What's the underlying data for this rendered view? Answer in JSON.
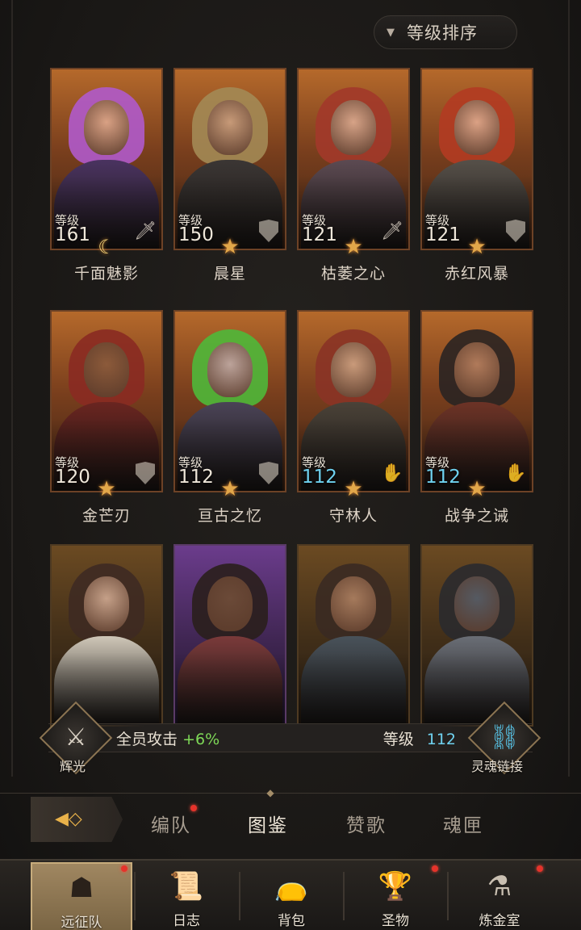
{
  "sort": {
    "label": "等级排序"
  },
  "heroes": [
    {
      "name": "千面魅影",
      "level_caption": "等级",
      "level": "161",
      "class": "sword-icon",
      "star": "moon-icon",
      "palette": [
        "#b05acb",
        "#d9a184",
        "#4a3360"
      ]
    },
    {
      "name": "晨星",
      "level_caption": "等级",
      "level": "150",
      "class": "shield-icon",
      "star": "star-icon",
      "palette": [
        "#a38a55",
        "#c79a78",
        "#3b3634"
      ]
    },
    {
      "name": "枯萎之心",
      "level_caption": "等级",
      "level": "121",
      "class": "sword-icon",
      "star": "star-icon",
      "palette": [
        "#a2382a",
        "#d7a387",
        "#5c4a52"
      ]
    },
    {
      "name": "赤红风暴",
      "level_caption": "等级",
      "level": "121",
      "class": "shield-icon",
      "star": "star-icon",
      "palette": [
        "#b23b22",
        "#dba184",
        "#565049"
      ]
    },
    {
      "name": "金芒刃",
      "level_caption": "等级",
      "level": "120",
      "class": "shield-icon",
      "star": "star-icon",
      "palette": [
        "#8a2a22",
        "#8c5a3a",
        "#6a2520"
      ]
    },
    {
      "name": "亘古之忆",
      "level_caption": "等级",
      "level": "112",
      "class": "shield-icon",
      "star": "star-icon",
      "palette": [
        "#4fb83a",
        "#bca39a",
        "#4a4356"
      ]
    },
    {
      "name": "守林人",
      "level_caption": "等级",
      "level": "112",
      "level_color": "cyan",
      "class": "hand-icon",
      "star": "star-icon",
      "palette": [
        "#8a3326",
        "#c99a7a",
        "#4a4238"
      ]
    },
    {
      "name": "战争之诫",
      "level_caption": "等级",
      "level": "112",
      "level_color": "cyan",
      "class": "hand-icon",
      "star": "star-icon",
      "palette": [
        "#2a2422",
        "#b07a5a",
        "#6d3326"
      ]
    },
    {
      "name": "",
      "palette": [
        "#3e2a22",
        "#c5a088",
        "#cfc7b8"
      ]
    },
    {
      "name": "",
      "palette": [
        "#2a1f1c",
        "#6b4a38",
        "#7a3a3a"
      ]
    },
    {
      "name": "",
      "palette": [
        "#3a2a22",
        "#a57a5c",
        "#49525a"
      ]
    },
    {
      "name": "",
      "palette": [
        "#2a2a2e",
        "#555a62",
        "#6a6e76"
      ]
    }
  ],
  "stats": {
    "left_badge": {
      "label": "辉光",
      "icon": "sword-emblem-icon"
    },
    "buff_label": "全员攻击",
    "buff_value": "+6%",
    "level_label": "等级",
    "level_value": "112",
    "right_badge": {
      "label": "灵魂链接",
      "icon": "chain-link-icon"
    }
  },
  "tabs": [
    {
      "label": "编队",
      "badge": true
    },
    {
      "label": "图鉴",
      "active": true
    },
    {
      "label": "赞歌"
    },
    {
      "label": "魂匣"
    }
  ],
  "nav": [
    {
      "label": "远征队",
      "icon": "horned-helmet-icon",
      "active": true,
      "badge": true
    },
    {
      "label": "日志",
      "icon": "scroll-icon"
    },
    {
      "label": "背包",
      "icon": "bag-icon"
    },
    {
      "label": "圣物",
      "icon": "chalice-icon",
      "badge": true
    },
    {
      "label": "炼金室",
      "icon": "alchemy-icon",
      "badge": true
    }
  ],
  "colors": {
    "accent_gold": "#e2a74a",
    "level_cyan": "#6fd2f0",
    "buff_green": "#7ed957",
    "badge_red": "#e5332b"
  }
}
